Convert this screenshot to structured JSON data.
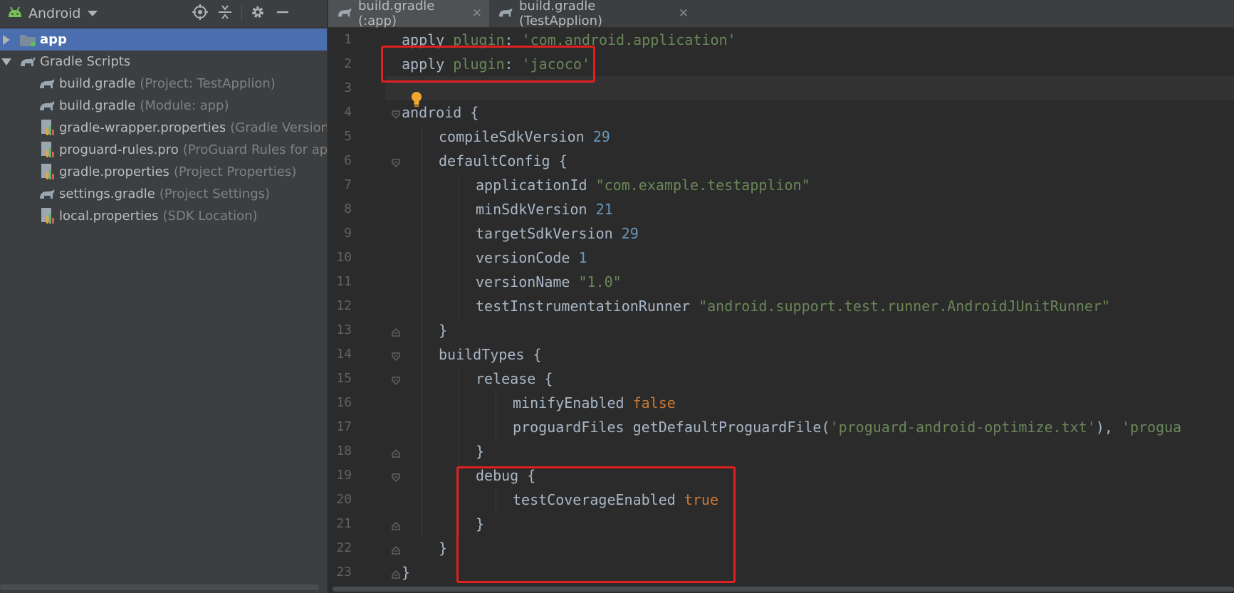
{
  "project_panel": {
    "view_selector": "Android",
    "toolbar_icons": [
      "locate-icon",
      "collapse-all-icon",
      "gear-icon",
      "minimize-icon"
    ],
    "tree": [
      {
        "name": "app",
        "hint": "",
        "icon": "folder-module-icon",
        "state": "collapsed",
        "selected": true
      },
      {
        "name": "Gradle Scripts",
        "hint": "",
        "icon": "gradle-icon",
        "state": "expanded",
        "selected": false
      },
      {
        "name": "build.gradle",
        "hint": "(Project: TestApplion)",
        "icon": "gradle-file-icon"
      },
      {
        "name": "build.gradle",
        "hint": "(Module: app)",
        "icon": "gradle-file-icon"
      },
      {
        "name": "gradle-wrapper.properties",
        "hint": "(Gradle Version)",
        "icon": "properties-file-icon"
      },
      {
        "name": "proguard-rules.pro",
        "hint": "(ProGuard Rules for app",
        "icon": "properties-file-icon"
      },
      {
        "name": "gradle.properties",
        "hint": "(Project Properties)",
        "icon": "properties-file-icon"
      },
      {
        "name": "settings.gradle",
        "hint": "(Project Settings)",
        "icon": "gradle-file-icon"
      },
      {
        "name": "local.properties",
        "hint": "(SDK Location)",
        "icon": "properties-file-icon"
      }
    ]
  },
  "editor": {
    "tabs": [
      {
        "label": "build.gradle (:app)",
        "active": true,
        "close": "✕"
      },
      {
        "label": "build.gradle (TestApplion)",
        "active": false,
        "close": "✕"
      }
    ],
    "line_numbers": [
      "1",
      "2",
      "3",
      "4",
      "5",
      "6",
      "7",
      "8",
      "9",
      "10",
      "11",
      "12",
      "13",
      "14",
      "15",
      "16",
      "17",
      "18",
      "19",
      "20",
      "21",
      "22",
      "23"
    ],
    "code": {
      "l1": {
        "a": "apply ",
        "b": "plugin",
        "c": ": ",
        "d": "'com.android.application'"
      },
      "l2": {
        "a": "apply ",
        "b": "plugin",
        "c": ": ",
        "d": "'jacoco'"
      },
      "l4": "android {",
      "l5": {
        "key": "compileSdkVersion ",
        "val": "29"
      },
      "l6": "defaultConfig {",
      "l7": {
        "key": "applicationId ",
        "val": "\"com.example.testapplion\""
      },
      "l8": {
        "key": "minSdkVersion ",
        "val": "21"
      },
      "l9": {
        "key": "targetSdkVersion ",
        "val": "29"
      },
      "l10": {
        "key": "versionCode ",
        "val": "1"
      },
      "l11": {
        "key": "versionName ",
        "val": "\"1.0\""
      },
      "l12": {
        "key": "testInstrumentationRunner ",
        "val": "\"android.support.test.runner.AndroidJUnitRunner\""
      },
      "l13": "}",
      "l14": "buildTypes {",
      "l15": "release {",
      "l16": {
        "key": "minifyEnabled ",
        "val": "false"
      },
      "l17": {
        "a": "proguardFiles getDefaultProguardFile(",
        "b": "'proguard-android-optimize.txt'",
        "c": "), ",
        "d": "'progua"
      },
      "l18": "}",
      "l19": "debug {",
      "l20": {
        "key": "testCoverageEnabled ",
        "val": "true"
      },
      "l21": "}",
      "l22": "}",
      "l23": "}"
    }
  },
  "colors": {
    "highlight_box": "#e0201f",
    "keyword": "#cc7832",
    "string": "#6a8759",
    "number": "#6897bb",
    "selection": "#4b6eaf"
  }
}
